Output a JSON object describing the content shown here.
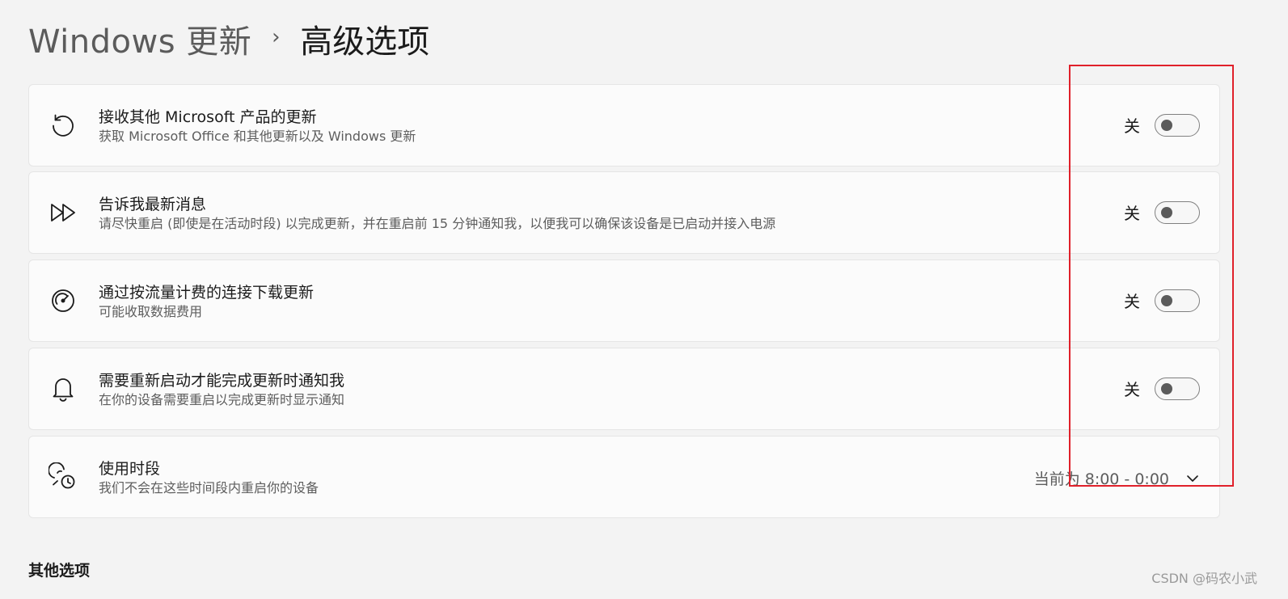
{
  "breadcrumb": {
    "parent": "Windows 更新",
    "separator": "›",
    "current": "高级选项"
  },
  "settings": [
    {
      "title": "接收其他 Microsoft 产品的更新",
      "subtitle": "获取 Microsoft Office 和其他更新以及 Windows 更新",
      "icon": "refresh-icon",
      "control": "toggle",
      "state_label": "关",
      "on": false
    },
    {
      "title": "告诉我最新消息",
      "subtitle": "请尽快重启 (即使是在活动时段) 以完成更新，并在重启前 15 分钟通知我，以便我可以确保该设备是已启动并接入电源",
      "icon": "fast-forward-icon",
      "control": "toggle",
      "state_label": "关",
      "on": false
    },
    {
      "title": "通过按流量计费的连接下载更新",
      "subtitle": "可能收取数据费用",
      "icon": "speedometer-icon",
      "control": "toggle",
      "state_label": "关",
      "on": false
    },
    {
      "title": "需要重新启动才能完成更新时通知我",
      "subtitle": "在你的设备需要重启以完成更新时显示通知",
      "icon": "bell-icon",
      "control": "toggle",
      "state_label": "关",
      "on": false
    },
    {
      "title": "使用时段",
      "subtitle": "我们不会在这些时间段内重启你的设备",
      "icon": "active-hours-icon",
      "control": "dropdown",
      "value": "当前为 8:00 - 0:00"
    }
  ],
  "other_options_heading": "其他选项",
  "watermark": "CSDN @码农小武",
  "colors": {
    "background": "#f3f3f3",
    "card": "#fbfbfb",
    "highlight": "#e0202a"
  }
}
